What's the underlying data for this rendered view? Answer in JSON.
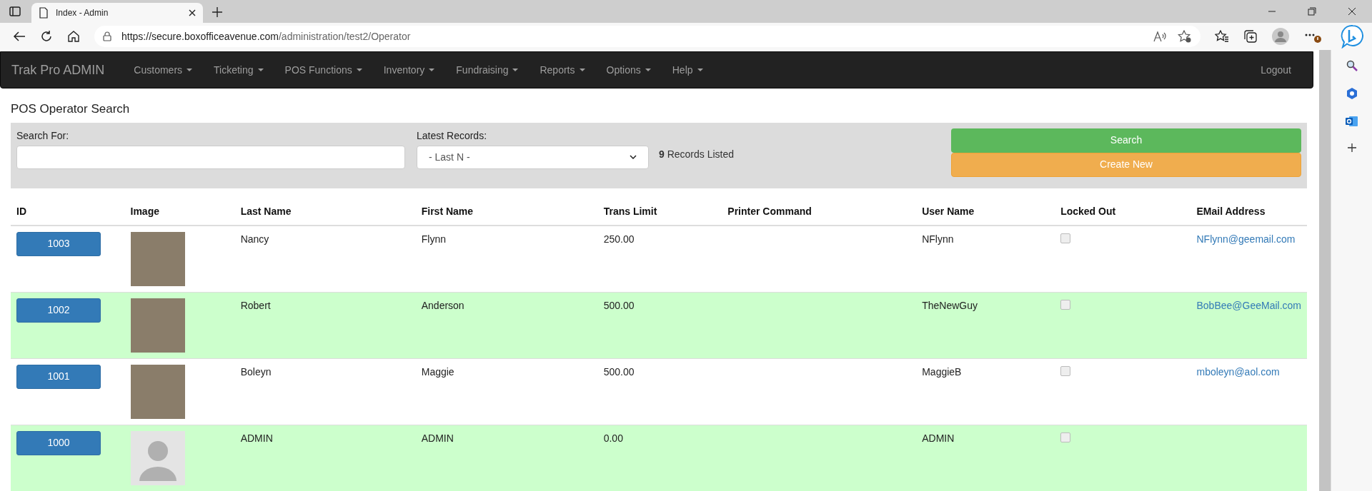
{
  "browser": {
    "tab_title": "Index - Admin",
    "url_host": "https://secure.boxofficeavenue.com",
    "url_path": "/administration/test2/Operator"
  },
  "navbar": {
    "brand": "Trak Pro ADMIN",
    "menus": [
      "Customers",
      "Ticketing",
      "POS Functions",
      "Inventory",
      "Fundraising",
      "Reports",
      "Options",
      "Help"
    ],
    "logout": "Logout"
  },
  "page_title": "POS Operator Search",
  "search": {
    "label": "Search For:"
  },
  "latest": {
    "label": "Latest Records:",
    "value": "- Last N -"
  },
  "records": {
    "count": "9",
    "text": "Records Listed"
  },
  "buttons": {
    "search": "Search",
    "create": "Create New"
  },
  "table": {
    "columns": [
      "ID",
      "Image",
      "Last Name",
      "First Name",
      "Trans Limit",
      "Printer Command",
      "User Name",
      "Locked Out",
      "EMail Address"
    ],
    "rows": [
      {
        "id": "1003",
        "kind": "photo",
        "last_name": "Nancy",
        "first_name": "Flynn",
        "trans_limit": "250.00",
        "user_name": "NFlynn",
        "locked_out": false,
        "email": "NFlynn@geemail.com"
      },
      {
        "id": "1002",
        "kind": "photo",
        "last_name": "Robert",
        "first_name": "Anderson",
        "trans_limit": "500.00",
        "user_name": "TheNewGuy",
        "locked_out": false,
        "email": "BobBee@GeeMail.com"
      },
      {
        "id": "1001",
        "kind": "photo",
        "last_name": "Boleyn",
        "first_name": "Maggie",
        "trans_limit": "500.00",
        "user_name": "MaggieB",
        "locked_out": false,
        "email": "mboleyn@aol.com"
      },
      {
        "id": "1000",
        "kind": "default",
        "last_name": "ADMIN",
        "first_name": "ADMIN",
        "trans_limit": "0.00",
        "user_name": "ADMIN",
        "locked_out": false
      }
    ]
  }
}
